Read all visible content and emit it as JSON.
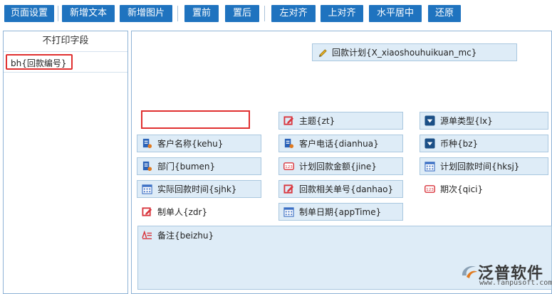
{
  "toolbar": {
    "page_settings": "页面设置",
    "add_text": "新增文本",
    "add_image": "新增图片",
    "bring_front": "置前",
    "send_back": "置后",
    "align_left": "左对齐",
    "align_top": "上对齐",
    "center_horizontal": "水平居中",
    "restore": "还原"
  },
  "left_panel": {
    "title": "不打印字段",
    "items": [
      "bh{回款编号}"
    ]
  },
  "canvas": {
    "title_field": "回款计划{X_xiaoshouhuikuan_mc}",
    "fields": {
      "zt": "主题{zt}",
      "lx": "源单类型{lx}",
      "kehu": "客户名称{kehu}",
      "dianhua": "客户电话{dianhua}",
      "bz": "币种{bz}",
      "bumen": "部门{bumen}",
      "jine": "计划回款金额{jine}",
      "hksj": "计划回款时间{hksj}",
      "sjhk": "实际回款时间{sjhk}",
      "danhao": "回款相关单号{danhao}",
      "qici": "期次{qici}",
      "zdr": "制单人{zdr}",
      "apptime": "制单日期{appTime}",
      "beizhu": "备注{beizhu}"
    }
  },
  "logo": {
    "name": "泛普软件",
    "url": "www.fanpusoft.com"
  },
  "colors": {
    "toolbar_button": "#1f73bf",
    "field_bg": "#deecf7",
    "field_border": "#a9c7df",
    "highlight_red": "#e03030",
    "icon_blue": "#2a62b8",
    "icon_red": "#d9363e",
    "icon_navy": "#1b4f86"
  },
  "icons": {
    "title_field": "pencil-icon",
    "text_field": "edit-icon",
    "select_field": "dropdown-icon",
    "person_field": "person-card-icon",
    "number_field": "number-icon",
    "date_field": "calendar-icon",
    "remark_field": "text-lines-icon"
  }
}
